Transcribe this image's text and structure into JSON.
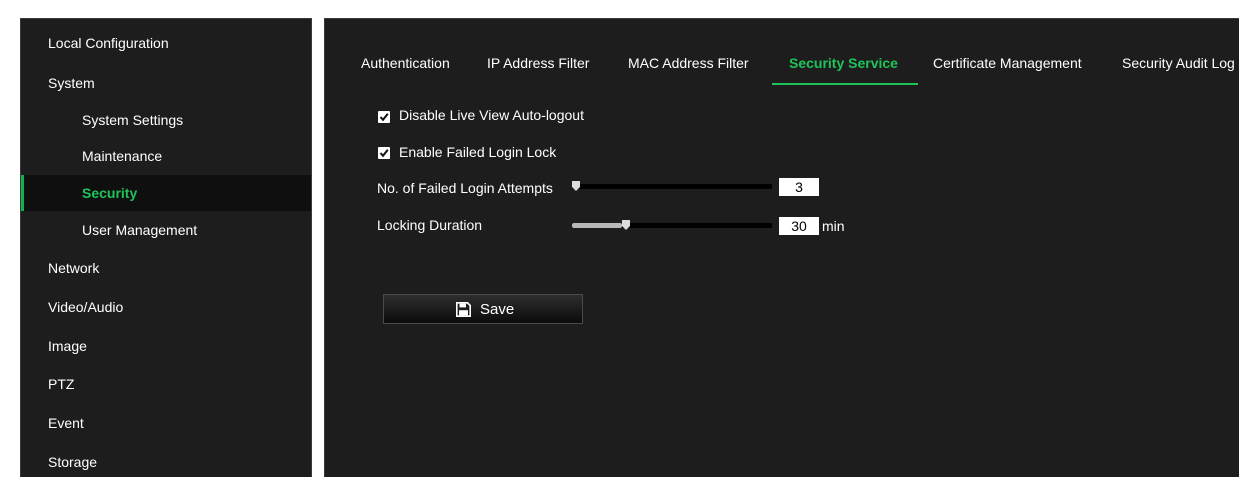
{
  "sidebar": {
    "items": [
      {
        "label": "Local Configuration"
      },
      {
        "label": "System"
      },
      {
        "label": "System Settings"
      },
      {
        "label": "Maintenance"
      },
      {
        "label": "Security"
      },
      {
        "label": "User Management"
      },
      {
        "label": "Network"
      },
      {
        "label": "Video/Audio"
      },
      {
        "label": "Image"
      },
      {
        "label": "PTZ"
      },
      {
        "label": "Event"
      },
      {
        "label": "Storage"
      }
    ],
    "active_item": "Security"
  },
  "tabs": [
    {
      "label": "Authentication"
    },
    {
      "label": "IP Address Filter"
    },
    {
      "label": "MAC Address Filter"
    },
    {
      "label": "Security Service"
    },
    {
      "label": "Certificate Management"
    },
    {
      "label": "Security Audit Log"
    }
  ],
  "active_tab": "Security Service",
  "settings": {
    "disable_live_view_autologout": {
      "label": "Disable Live View Auto-logout",
      "checked": true
    },
    "enable_failed_login_lock": {
      "label": "Enable Failed Login Lock",
      "checked": true
    },
    "failed_login_attempts": {
      "label": "No. of Failed Login Attempts",
      "value": "3",
      "slider_fraction": 0.0
    },
    "locking_duration": {
      "label": "Locking Duration",
      "value": "30",
      "unit": "min",
      "slider_fraction": 0.25
    }
  },
  "save_button": {
    "label": "Save",
    "icon": "floppy-disk-icon"
  },
  "colors": {
    "accent": "#1ec45a",
    "panel_background": "#1d1d1d",
    "text": "#ffffff"
  }
}
